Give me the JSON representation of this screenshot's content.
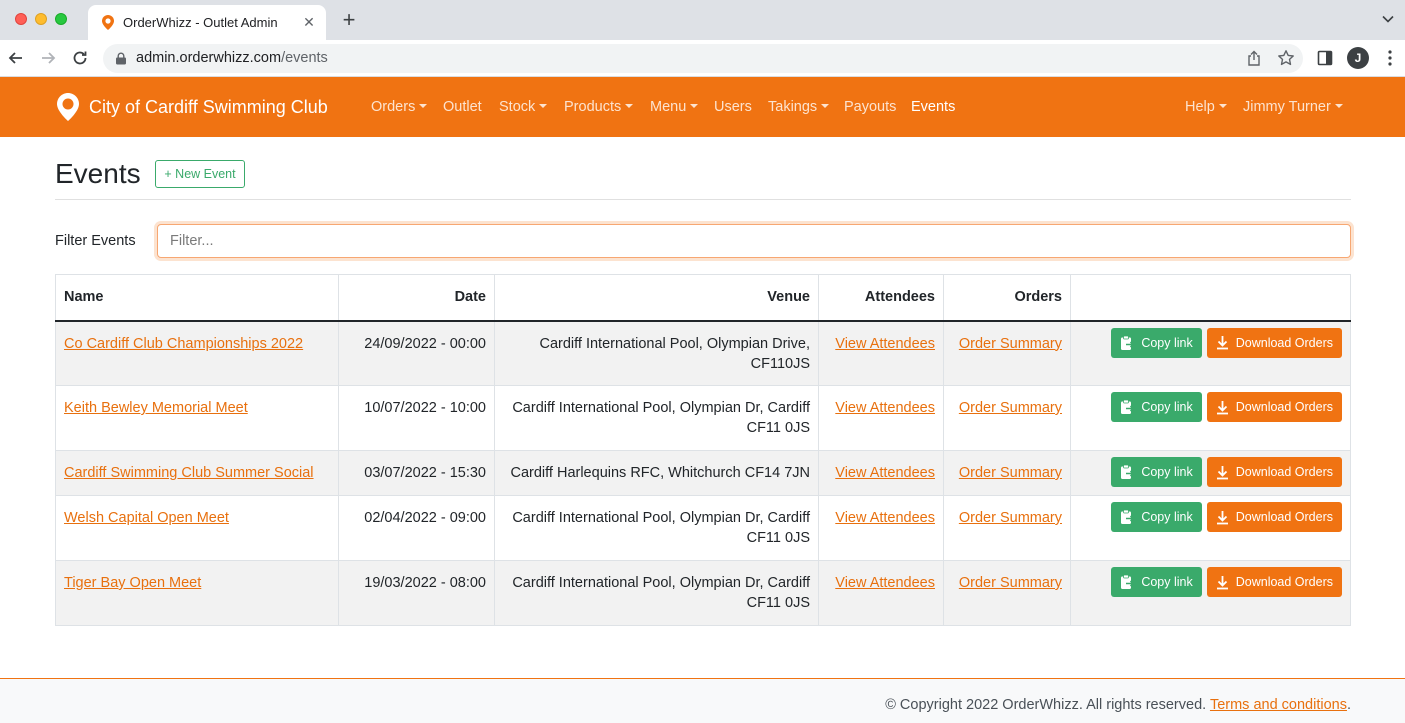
{
  "browser": {
    "tab_title": "OrderWhizz - Outlet Admin",
    "url_host": "admin.orderwhizz.com",
    "url_path": "/events",
    "profile_initial": "J"
  },
  "navbar": {
    "brand": "City of Cardiff Swimming Club",
    "items": [
      {
        "label": "Orders",
        "dropdown": true
      },
      {
        "label": "Outlet",
        "dropdown": false
      },
      {
        "label": "Stock",
        "dropdown": true
      },
      {
        "label": "Products",
        "dropdown": true
      },
      {
        "label": "Menu",
        "dropdown": true
      },
      {
        "label": "Users",
        "dropdown": false
      },
      {
        "label": "Takings",
        "dropdown": true
      },
      {
        "label": "Payouts",
        "dropdown": false
      },
      {
        "label": "Events",
        "dropdown": false,
        "active": true
      }
    ],
    "help": "Help",
    "user": "Jimmy Turner"
  },
  "page": {
    "title": "Events",
    "new_event_label": "+ New Event",
    "filter_label": "Filter Events",
    "filter_placeholder": "Filter...",
    "filter_value": ""
  },
  "table": {
    "headers": {
      "name": "Name",
      "date": "Date",
      "venue": "Venue",
      "attendees": "Attendees",
      "orders": "Orders"
    },
    "rows": [
      {
        "name": "Co Cardiff Club Championships 2022",
        "date": "24/09/2022 - 00:00",
        "venue_line1": "Cardiff International Pool, Olympian Drive,",
        "venue_line2": "CF110JS",
        "attendees": "View Attendees",
        "orders": "Order Summary",
        "copy": "Copy link",
        "download": "Download Orders"
      },
      {
        "name": "Keith Bewley Memorial Meet",
        "date": "10/07/2022 - 10:00",
        "venue_line1": "Cardiff International Pool, Olympian Dr, Cardiff",
        "venue_line2": "CF11 0JS",
        "attendees": "View Attendees",
        "orders": "Order Summary",
        "copy": "Copy link",
        "download": "Download Orders"
      },
      {
        "name": "Cardiff Swimming Club Summer Social",
        "date": "03/07/2022 - 15:30",
        "venue_line1": "Cardiff Harlequins RFC, Whitchurch CF14 7JN",
        "venue_line2": "",
        "attendees": "View Attendees",
        "orders": "Order Summary",
        "copy": "Copy link",
        "download": "Download Orders"
      },
      {
        "name": "Welsh Capital Open Meet",
        "date": "02/04/2022 - 09:00",
        "venue_line1": "Cardiff International Pool, Olympian Dr, Cardiff",
        "venue_line2": "CF11 0JS",
        "attendees": "View Attendees",
        "orders": "Order Summary",
        "copy": "Copy link",
        "download": "Download Orders"
      },
      {
        "name": "Tiger Bay Open Meet",
        "date": "19/03/2022 - 08:00",
        "venue_line1": "Cardiff International Pool, Olympian Dr, Cardiff",
        "venue_line2": "CF11 0JS",
        "attendees": "View Attendees",
        "orders": "Order Summary",
        "copy": "Copy link",
        "download": "Download Orders"
      }
    ]
  },
  "footer": {
    "copyright": "© Copyright 2022 OrderWhizz. All rights reserved.",
    "terms": "Terms and conditions",
    "period": "."
  },
  "colors": {
    "brand_orange": "#f07312",
    "copy_green": "#3aaa6b",
    "link_orange": "#e8700e"
  }
}
